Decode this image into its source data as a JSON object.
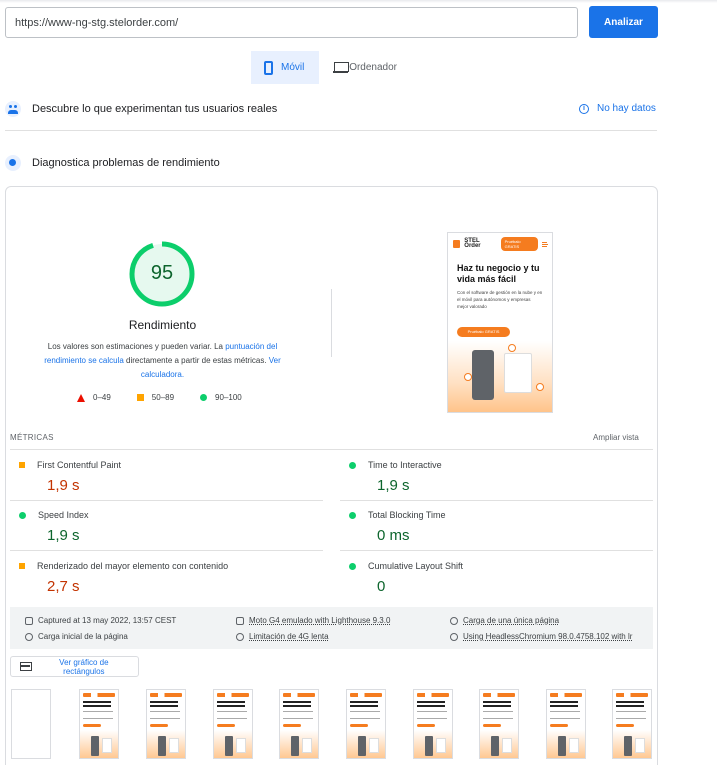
{
  "search": {
    "url_value": "https://www-ng-stg.stelorder.com/",
    "analyze_label": "Analizar"
  },
  "tabs": [
    {
      "label": "Móvil",
      "active": true
    },
    {
      "label": "Ordenador",
      "active": false
    }
  ],
  "field_data": {
    "title": "Descubre lo que experimentan tus usuarios reales",
    "status": "No hay datos"
  },
  "lab_data": {
    "title": "Diagnostica problemas de rendimiento"
  },
  "score": {
    "value": 95,
    "value_text": "95",
    "label": "Rendimiento",
    "desc_part1": "Los valores son estimaciones y pueden variar. La ",
    "desc_link1": "puntuación del rendimiento se calcula",
    "desc_part2": " directamente a partir de estas métricas. ",
    "desc_link2": "Ver calculadora.",
    "color": "#0cce6b"
  },
  "legend": [
    {
      "shape": "triangle",
      "range": "0–49",
      "color": "#eb0f00"
    },
    {
      "shape": "square",
      "range": "50–89",
      "color": "#ffa400"
    },
    {
      "shape": "circle",
      "range": "90–100",
      "color": "#0cce6b"
    }
  ],
  "screenshot": {
    "brand": "STEL Order",
    "pill": "Pruébalo GRATIS",
    "headline": "Haz tu negocio y tu vida más fácil",
    "body": "Con el software de gestión en la nube y en el móvil para autónomos y empresas mejor valorado",
    "cta": "Pruébalo GRATIS"
  },
  "metrics": {
    "title": "MÉTRICAS",
    "expand_label": "Ampliar vista",
    "items": [
      {
        "label": "First Contentful Paint",
        "value": "1,9 s",
        "rating": "average"
      },
      {
        "label": "Time to Interactive",
        "value": "1,9 s",
        "rating": "good"
      },
      {
        "label": "Speed Index",
        "value": "1,9 s",
        "rating": "good"
      },
      {
        "label": "Total Blocking Time",
        "value": "0 ms",
        "rating": "good"
      },
      {
        "label": "Renderizado del mayor elemento con contenido",
        "value": "2,7 s",
        "rating": "average"
      },
      {
        "label": "Cumulative Layout Shift",
        "value": "0",
        "rating": "good"
      }
    ]
  },
  "environment": {
    "captured": "Captured at 13 may 2022, 13:57 CEST",
    "device": "Moto G4 emulado with Lighthouse 9.3.0",
    "load": "Carga de una única página",
    "initial": "Carga inicial de la página",
    "throttle": "Limitación de 4G lenta",
    "browser": "Using HeadlessChromium 98.0.4758.102 with lr"
  },
  "treemap": {
    "label": "Ver gráfico de rectángulos"
  },
  "colors": {
    "accent": "#1a73e8",
    "good": "#0cce6b",
    "average": "#ffa400",
    "poor": "#eb0f00"
  }
}
